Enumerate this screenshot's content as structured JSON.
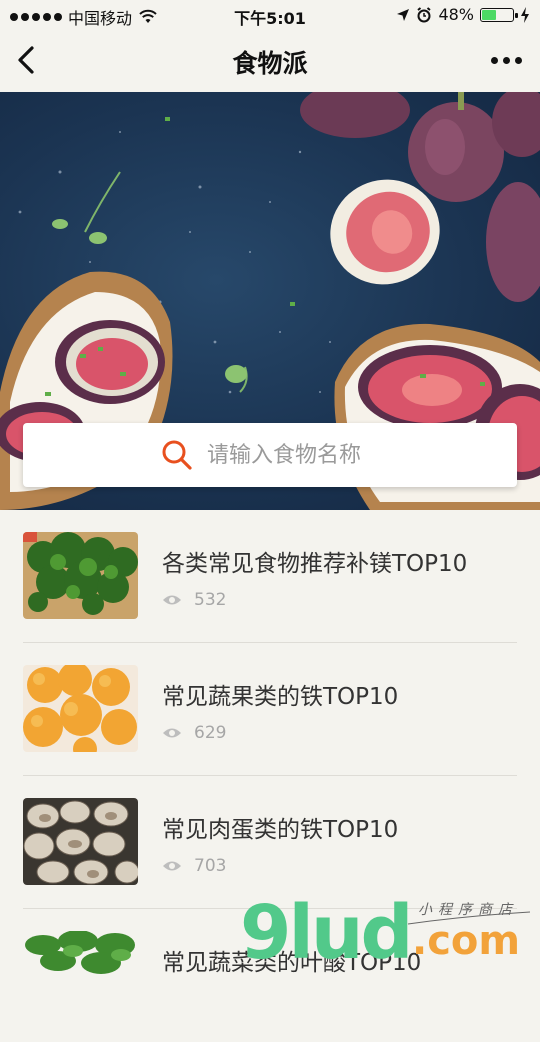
{
  "status_bar": {
    "carrier": "中国移动",
    "time": "下午5:01",
    "battery": "48%",
    "battery_level": 0.48
  },
  "nav": {
    "title": "食物派"
  },
  "search": {
    "placeholder": "请输入食物名称"
  },
  "list": [
    {
      "title": "各类常见食物推荐补镁TOP10",
      "views": "532",
      "thumb": "leafy-greens"
    },
    {
      "title": "常见蔬果类的铁TOP10",
      "views": "629",
      "thumb": "apricots"
    },
    {
      "title": "常见肉蛋类的铁TOP10",
      "views": "703",
      "thumb": "clams"
    },
    {
      "title": "常见蔬菜类的叶酸TOP10",
      "views": "",
      "thumb": "spinach"
    }
  ],
  "watermark": {
    "brand": "9lud",
    "suffix": ".com",
    "tagline": "小程序商店"
  },
  "colors": {
    "accent": "#e8501f",
    "background": "#f4f3ee",
    "watermark_green": "#52c98a",
    "watermark_orange": "#f2a23a"
  }
}
